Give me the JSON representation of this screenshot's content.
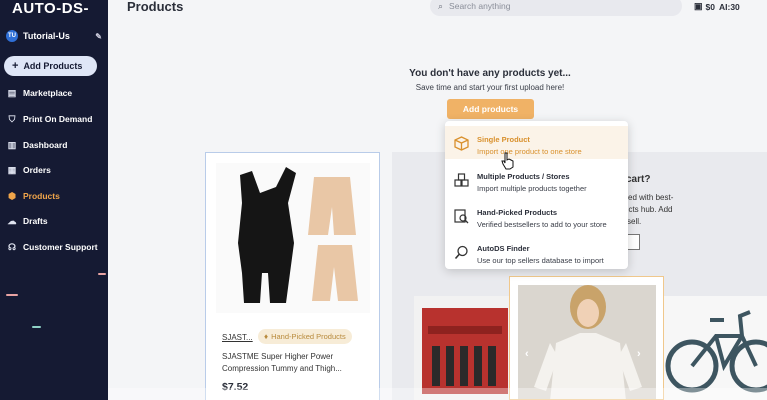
{
  "sidebar": {
    "logo": "AUTO-DS-",
    "store_badge": "TU",
    "store_name": "Tutorial-Us",
    "add_button": "Add Products",
    "items": [
      {
        "label": "Marketplace",
        "icon": "marketplace-icon"
      },
      {
        "label": "Print On Demand",
        "icon": "tshirt-icon"
      },
      {
        "label": "Dashboard",
        "icon": "dashboard-icon"
      },
      {
        "label": "Orders",
        "icon": "orders-icon"
      },
      {
        "label": "Products",
        "icon": "box-icon",
        "active": true
      },
      {
        "label": "Drafts",
        "icon": "drafts-icon"
      },
      {
        "label": "Customer Support",
        "icon": "support-icon"
      }
    ]
  },
  "header": {
    "title": "Products",
    "search_placeholder": "Search anything",
    "balance": "$0",
    "ai_credits": "AI:30"
  },
  "empty_state": {
    "title": "You don't have any products yet...",
    "subtitle": "Save time and start your first upload here!",
    "button": "Add products"
  },
  "dropdown": {
    "items": [
      {
        "title": "Single Product",
        "desc": "Import one product to one store",
        "icon": "box-icon",
        "highlighted": true
      },
      {
        "title": "Multiple Products / Stores",
        "desc": "Import multiple products together",
        "icon": "boxes-icon"
      },
      {
        "title": "Hand-Picked Products",
        "desc": "Verified bestsellers to add to your store",
        "icon": "verified-search-icon"
      },
      {
        "title": "AutoDS Finder",
        "desc": "Use our top sellers database to import",
        "icon": "search-icon"
      }
    ]
  },
  "product_card": {
    "vendor": "SJAST...",
    "tag": "Hand-Picked Products",
    "name": "SJASTME Super Higher Power Compression Tummy and Thigh...",
    "price": "$7.52"
  },
  "panel": {
    "fragments": [
      "cart?",
      "ed with best-",
      "ucts hub. Add",
      "sell."
    ]
  },
  "colors": {
    "sidebar_bg": "#151a33",
    "accent": "#f0a54a",
    "button": "#f0b266"
  }
}
